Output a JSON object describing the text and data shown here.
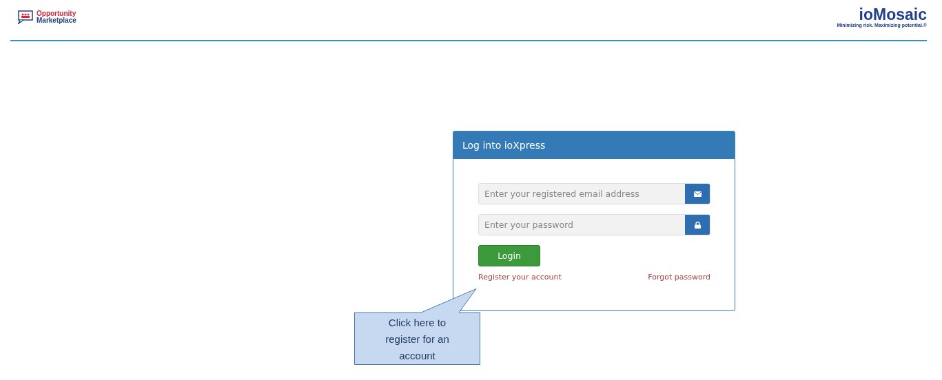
{
  "header": {
    "brand": {
      "line_1": "Opportunity",
      "line_2": "Marketplace"
    },
    "partner_logo": {
      "name": "ioMosaic",
      "tagline": "Minimizing risk. Maximizing potential.®"
    }
  },
  "login_panel": {
    "title": "Log into ioXpress",
    "fields": [
      {
        "kind": "email",
        "placeholder": "Enter your registered email address"
      },
      {
        "kind": "password",
        "placeholder": "Enter your password"
      }
    ],
    "login_button": "Login",
    "register_link": "Register your account",
    "forgot_link": "Forgot password"
  },
  "callout": {
    "text": "Click here to register for an account"
  }
}
